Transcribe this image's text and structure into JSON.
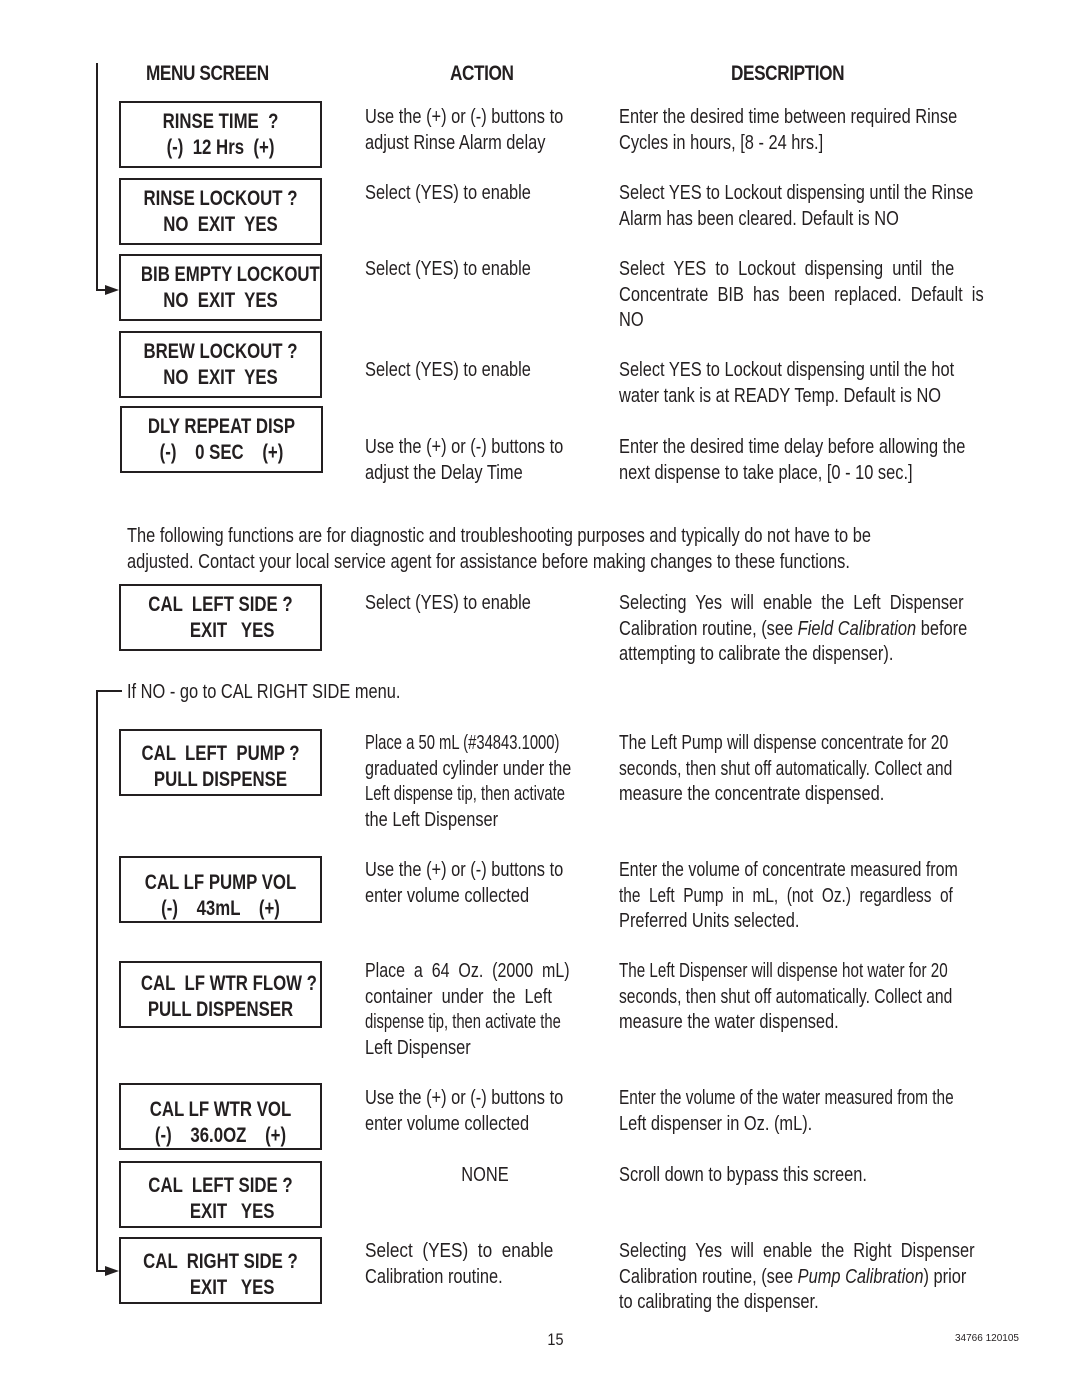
{
  "headers": {
    "menu_screen": "MENU SCREEN",
    "action": "ACTION",
    "description": "DESCRIPTION"
  },
  "rows": [
    {
      "screen": [
        "RINSE TIME  ?",
        "(-)  12 Hrs  (+)"
      ],
      "action": [
        "Use the (+) or (-) buttons to",
        "adjust Rinse Alarm delay"
      ],
      "description": [
        "Enter the desired time between required Rinse",
        "Cycles in hours, [8 - 24 hrs.]"
      ]
    },
    {
      "screen": [
        "RINSE LOCKOUT ?",
        "NO  EXIT  YES"
      ],
      "action": [
        "Select (YES) to enable"
      ],
      "description": [
        "Select YES to Lockout dispensing until the Rinse",
        "Alarm has been cleared. Default is NO"
      ]
    },
    {
      "screen": [
        "BIB EMPTY LOCKOUT",
        "NO  EXIT  YES"
      ],
      "action": [
        "Select (YES) to enable"
      ],
      "description": [
        "Select  YES  to  Lockout  dispensing  until  the",
        "Concentrate  BIB  has  been  replaced.  Default  is",
        "NO"
      ]
    },
    {
      "screen": [
        "BREW LOCKOUT ?",
        "NO  EXIT  YES"
      ],
      "action": [
        "Select (YES) to enable"
      ],
      "description": [
        "Select YES to Lockout dispensing until the hot",
        "water tank is at READY Temp. Default is NO"
      ]
    },
    {
      "screen": [
        "DLY REPEAT DISP",
        "(-)    0 SEC    (+)"
      ],
      "action": [
        "Use the (+) or (-) buttons to",
        "adjust the Delay Time"
      ],
      "description": [
        "Enter the desired time delay before allowing the",
        "next dispense to take place, [0 - 10 sec.]"
      ]
    }
  ],
  "diagnostic_note": [
    "The following functions are for diagnostic and troubleshooting purposes and typically do not have to be",
    "adjusted. Contact your local service agent for assistance before making changes to these functions."
  ],
  "cal_left_side": {
    "screen": [
      "CAL  LEFT SIDE ?",
      "     EXIT   YES"
    ],
    "action": [
      "Select (YES) to enable"
    ],
    "description": {
      "line1": "Selecting  Yes  will  enable  the  Left  Dispenser",
      "line2_pre": "Calibration routine, (see ",
      "line2_em": "Field Calibration",
      "line2_post": " before",
      "line3": "attempting to calibrate the dispenser)."
    }
  },
  "if_no_note": "If NO - go to CAL RIGHT SIDE menu.",
  "cal_rows": [
    {
      "screen": [
        "CAL  LEFT  PUMP ?",
        "PULL DISPENSE"
      ],
      "action": [
        "Place a 50 mL (#34843.1000)",
        "graduated cylinder under the",
        "Left dispense tip, then activate",
        "the Left Dispenser"
      ],
      "description": [
        "The Left Pump will dispense concentrate for 20",
        "seconds, then shut off automatically. Collect and",
        "measure the concentrate dispensed."
      ]
    },
    {
      "screen": [
        "CAL LF PUMP VOL",
        "(-)    43mL    (+)"
      ],
      "action": [
        "Use the (+) or (-) buttons to",
        "enter volume collected"
      ],
      "description": [
        "Enter the volume of concentrate measured from",
        "the  Left  Pump  in  mL,  (not  Oz.)  regardless  of",
        "Preferred Units selected."
      ]
    },
    {
      "screen": [
        "CAL  LF WTR FLOW ?",
        "PULL DISPENSER"
      ],
      "action": [
        "Place  a  64  Oz.  (2000  mL)",
        "container  under  the  Left",
        "dispense tip, then activate the",
        "Left Dispenser"
      ],
      "description": [
        "The Left Dispenser will dispense hot water for 20",
        "seconds, then shut off automatically. Collect and",
        "measure the water dispensed."
      ]
    },
    {
      "screen": [
        "CAL LF WTR VOL",
        "(-)    36.0OZ    (+)"
      ],
      "action": [
        "Use the (+) or (-) buttons to",
        "enter volume collected"
      ],
      "description": [
        "Enter the volume of the water measured from the",
        "Left dispenser in Oz. (mL)."
      ]
    },
    {
      "screen": [
        "CAL  LEFT SIDE ?",
        "     EXIT   YES"
      ],
      "action": [
        "NONE"
      ],
      "description": [
        "Scroll down to bypass this screen."
      ]
    }
  ],
  "cal_right_side": {
    "screen": [
      "CAL  RIGHT SIDE ?",
      "     EXIT   YES"
    ],
    "action": [
      "Select  (YES)  to  enable",
      "Calibration routine."
    ],
    "description": {
      "line1": "Selecting  Yes  will  enable  the  Right  Dispenser",
      "line2_pre": "Calibration routine, (see ",
      "line2_em": "Pump Calibration",
      "line2_post": ") prior",
      "line3": "to calibrating the dispenser."
    }
  },
  "footer": {
    "page_number": "15",
    "doc_number": "34766 120105"
  }
}
